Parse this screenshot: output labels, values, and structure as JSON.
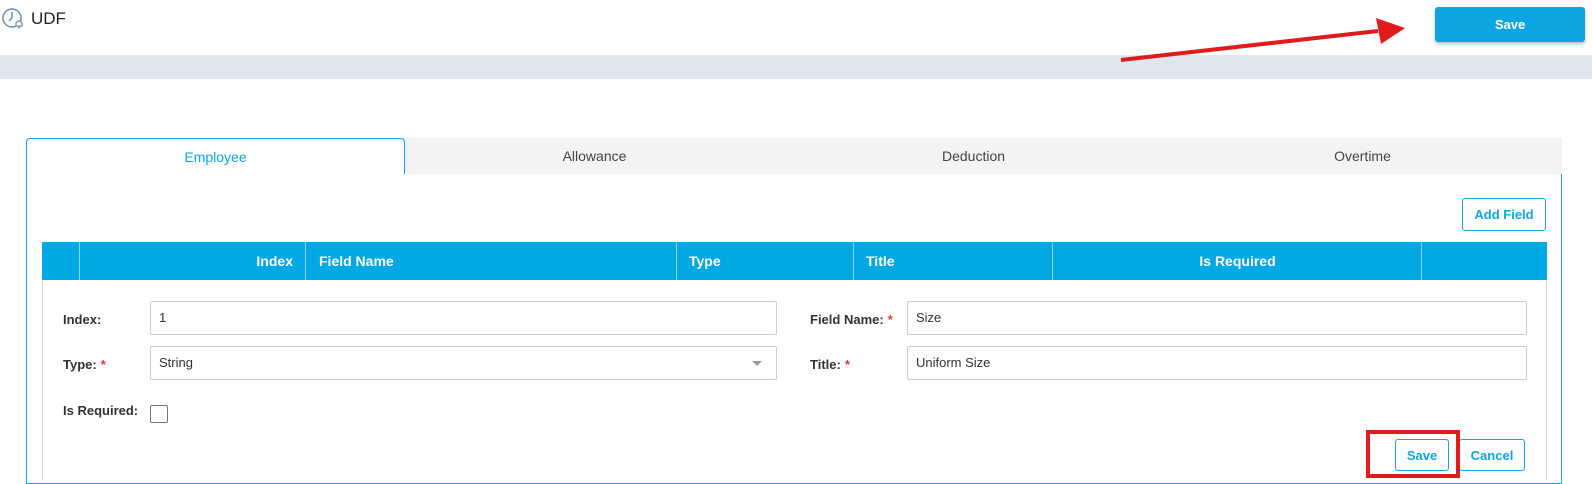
{
  "header": {
    "title": "UDF",
    "icon": "clock-bell-icon",
    "save_label": "Save"
  },
  "tabs": [
    {
      "label": "Employee",
      "active": true
    },
    {
      "label": "Allowance",
      "active": false
    },
    {
      "label": "Deduction",
      "active": false
    },
    {
      "label": "Overtime",
      "active": false
    }
  ],
  "toolbar": {
    "add_field_label": "Add Field"
  },
  "grid": {
    "columns": [
      "Index",
      "Field Name",
      "Type",
      "Title",
      "Is Required"
    ]
  },
  "form": {
    "index_label": "Index:",
    "index_value": "1",
    "field_name_label": "Field Name:",
    "field_name_value": "Size",
    "type_label": "Type:",
    "type_value": "String",
    "title_label": "Title:",
    "title_value": "Uniform Size",
    "is_required_label": "Is Required:",
    "is_required_checked": false,
    "required_marker": "*",
    "save_label": "Save",
    "cancel_label": "Cancel"
  },
  "colors": {
    "accent": "#0ea5e0",
    "grid_header": "#00a8e4",
    "required": "#e53935",
    "annotation": "#e01b1b"
  }
}
